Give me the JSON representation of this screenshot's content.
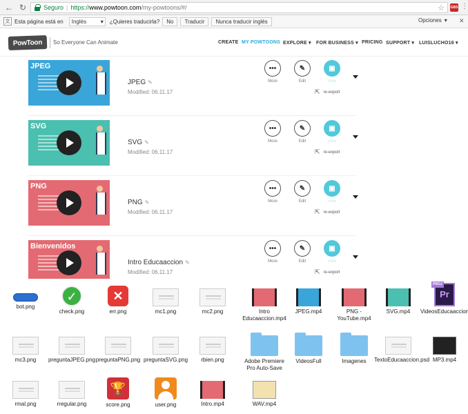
{
  "browser": {
    "secure_label": "Seguro",
    "url_protocol": "https://",
    "url_host": "www.powtoon.com",
    "url_path": "/my-powtoons/#/"
  },
  "translate_bar": {
    "prefix": "Esta página está en",
    "language": "Inglés",
    "question": "¿Quieres traducirla?",
    "no_label": "No",
    "translate_label": "Traducir",
    "never_label": "Nunca traducir inglés",
    "options_label": "Opciones"
  },
  "header": {
    "logo": "PowToon",
    "tagline": "So Everyone Can Animate",
    "nav": [
      "CREATE",
      "MY POWTOONS",
      "EXPLORE",
      "FOR BUSINESS",
      "PRICING",
      "SUPPORT",
      "LUISLUCHO16"
    ]
  },
  "powtoons": [
    {
      "thumb_title": "JPEG",
      "title": "JPEG",
      "modified": "Modified: 06.11.17",
      "thumb_color": "#3aa5d8"
    },
    {
      "thumb_title": "SVG",
      "title": "SVG",
      "modified": "Modified: 06.11.17",
      "thumb_color": "#4bbfb0"
    },
    {
      "thumb_title": "PNG",
      "title": "PNG",
      "modified": "Modified: 06.11.17",
      "thumb_color": "#e36a72"
    },
    {
      "thumb_title": "Bienvenidos",
      "title": "Intro Educaaccion",
      "modified": "Modified: 06.11.17",
      "thumb_color": "#e36a72"
    }
  ],
  "actions": {
    "more": "More",
    "edit": "Edit",
    "view": "View",
    "reexport": "re-export",
    "more_glyph": "•••",
    "edit_glyph": "✎",
    "view_glyph": "▣"
  },
  "files": [
    {
      "name": "bot.png",
      "icon": "bot"
    },
    {
      "name": "check.png",
      "icon": "check"
    },
    {
      "name": "err.png",
      "icon": "err"
    },
    {
      "name": "mc1.png",
      "icon": "doc"
    },
    {
      "name": "mc2.png",
      "icon": "doc"
    },
    {
      "name": "Intro Educaaccion.mp4",
      "icon": "video"
    },
    {
      "name": "JPEG.mp4",
      "icon": "video"
    },
    {
      "name": "PNG - YouTube.mp4",
      "icon": "video"
    },
    {
      "name": "SVG.mp4",
      "icon": "video"
    },
    {
      "name": "VideosEducaaccion.prproj",
      "icon": "proj"
    },
    {
      "name": "mc3.png",
      "icon": "doc"
    },
    {
      "name": "preguntaJPEG.png",
      "icon": "doc"
    },
    {
      "name": "preguntaPNG.png",
      "icon": "doc"
    },
    {
      "name": "preguntaSVG.png",
      "icon": "doc"
    },
    {
      "name": "rbien.png",
      "icon": "doc"
    },
    {
      "name": "Adobe Premiere Pro Auto-Save",
      "icon": "folder"
    },
    {
      "name": "VideosFull",
      "icon": "folder"
    },
    {
      "name": "Imagenes",
      "icon": "folder"
    },
    {
      "name": "TextoEducaaccion.psd",
      "icon": "doc"
    },
    {
      "name": "MP3.mp4",
      "icon": "mp3"
    },
    {
      "name": "rmal.png",
      "icon": "doc"
    },
    {
      "name": "rregular.png",
      "icon": "doc"
    },
    {
      "name": "score.png",
      "icon": "trophy"
    },
    {
      "name": "user.png",
      "icon": "user"
    },
    {
      "name": "Intro.mp4",
      "icon": "video"
    },
    {
      "name": "WAV.mp4",
      "icon": "wav"
    }
  ],
  "colors": {
    "accent": "#29a8d8",
    "view_button": "#52c8db",
    "secure_green": "#0b8043"
  }
}
